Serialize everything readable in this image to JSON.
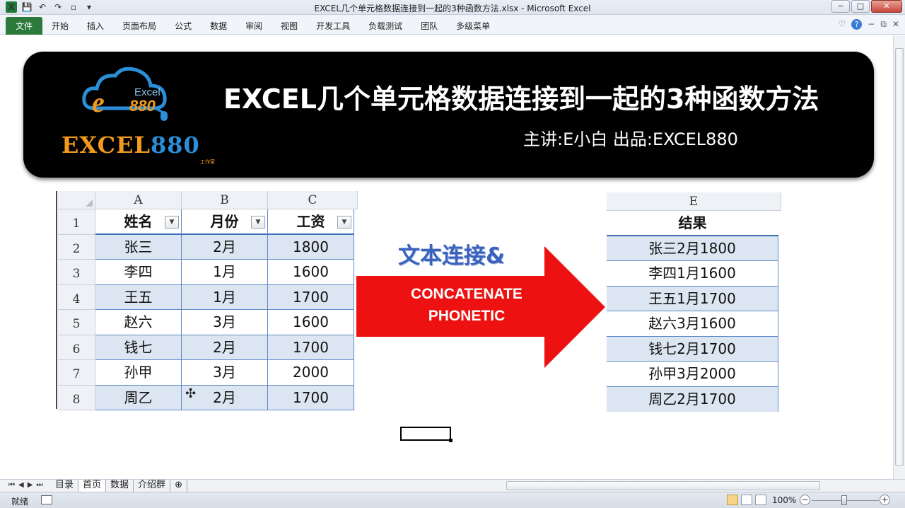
{
  "window": {
    "title": "EXCEL几个单元格数据连接到一起的3种函数方法.xlsx  -  Microsoft Excel",
    "min": "−",
    "max": "□",
    "close": "✕"
  },
  "ribbon": {
    "tabs": [
      "文件",
      "开始",
      "插入",
      "页面布局",
      "公式",
      "数据",
      "审阅",
      "视图",
      "开发工具",
      "负载测试",
      "团队",
      "多级菜单"
    ]
  },
  "banner": {
    "logo_small": "Excel",
    "logo_e": "e",
    "logo_880": "880",
    "logo_big_a": "EXCEL",
    "logo_big_b": "880",
    "logo_studio": "工作室",
    "title": "EXCEL几个单元格数据连接到一起的3种函数方法",
    "subtitle": "主讲:E小白   出品:EXCEL880"
  },
  "left_table": {
    "columns": [
      "A",
      "B",
      "C"
    ],
    "headers": [
      "姓名",
      "月份",
      "工资"
    ],
    "row_numbers": [
      "1",
      "2",
      "3",
      "4",
      "5",
      "6",
      "7",
      "8"
    ],
    "rows": [
      [
        "张三",
        "2月",
        "1800"
      ],
      [
        "李四",
        "1月",
        "1600"
      ],
      [
        "王五",
        "1月",
        "1700"
      ],
      [
        "赵六",
        "3月",
        "1600"
      ],
      [
        "钱七",
        "2月",
        "1700"
      ],
      [
        "孙甲",
        "3月",
        "2000"
      ],
      [
        "周乙",
        "2月",
        "1700"
      ]
    ]
  },
  "arrow": {
    "label_top": "文本连接&",
    "line1": "CONCATENATE",
    "line2": "PHONETIC"
  },
  "right_table": {
    "column": "E",
    "header": "结果",
    "rows": [
      "张三2月1800",
      "李四1月1600",
      "王五1月1700",
      "赵六3月1600",
      "钱七2月1700",
      "孙甲3月2000",
      "周乙2月1700"
    ]
  },
  "sheet_tabs": [
    "目录",
    "首页",
    "数据",
    "介绍群"
  ],
  "status": {
    "ready": "就绪",
    "zoom": "100%"
  },
  "colors": {
    "accent_green": "#2b7a3c",
    "arrow_red": "#ee1111",
    "table_band": "#dce6f2",
    "logo_orange": "#f39a1d",
    "logo_blue": "#2a8fd8"
  }
}
